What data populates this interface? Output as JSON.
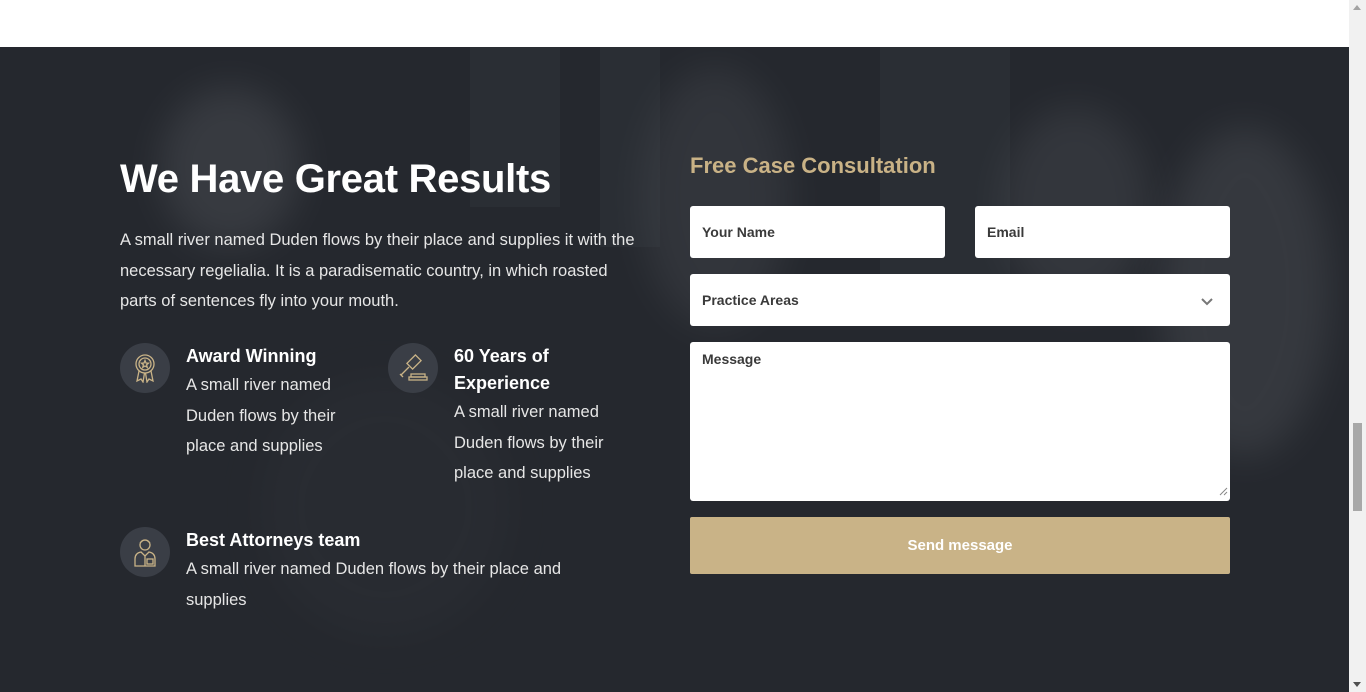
{
  "section": {
    "heading": "We Have Great Results",
    "intro": "A small river named Duden flows by their place and supplies it with the necessary regelialia. It is a paradisematic country, in which roasted parts of sentences fly into your mouth."
  },
  "features": [
    {
      "icon": "award-ribbon-icon",
      "title": "Award Winning",
      "text": "A small river named Duden flows by their place and supplies"
    },
    {
      "icon": "gavel-icon",
      "title": "60 Years of Experience",
      "text": "A small river named Duden flows by their place and supplies"
    },
    {
      "icon": "attorney-icon",
      "title": "Best Attorneys team",
      "text": "A small river named Duden flows by their place and supplies"
    }
  ],
  "form": {
    "title": "Free Case Consultation",
    "name_placeholder": "Your Name",
    "email_placeholder": "Email",
    "practice_selected": "Practice Areas",
    "message_placeholder": "Message",
    "submit_label": "Send message"
  },
  "colors": {
    "section_bg": "#25282e",
    "accent": "#c9b387",
    "icon_circle": "#3a3e46"
  }
}
